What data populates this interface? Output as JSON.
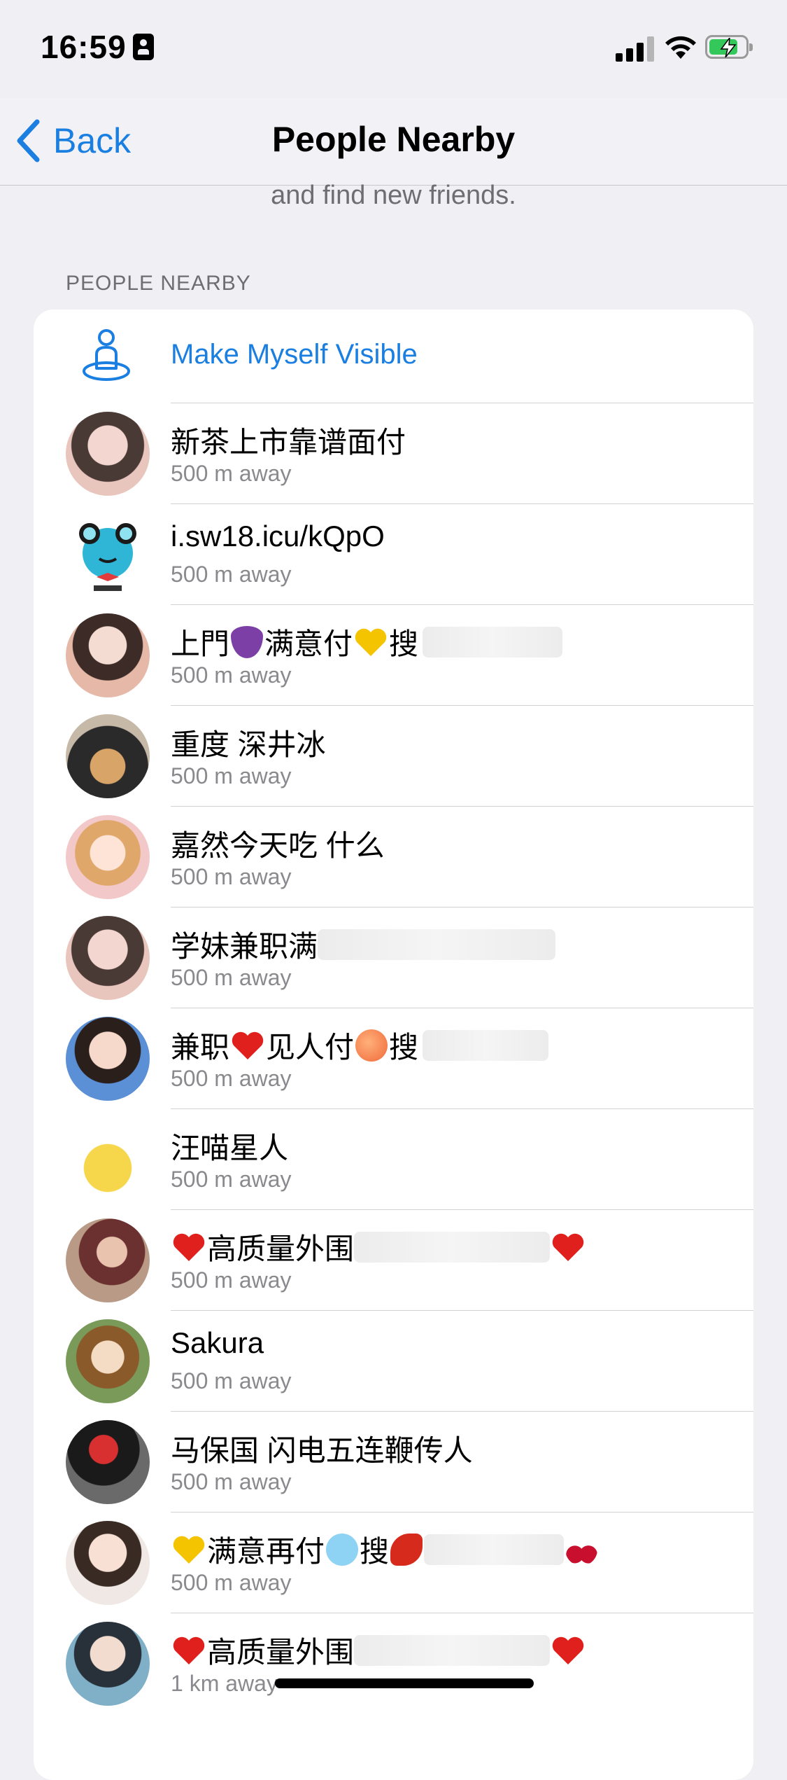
{
  "status": {
    "time": "16:59"
  },
  "nav": {
    "back_label": "Back",
    "title": "People Nearby"
  },
  "subtitle": "and find new friends.",
  "section_header": "PEOPLE NEARBY",
  "make_visible_label": "Make Myself Visible",
  "people": [
    {
      "name": "新茶上市靠谱面付",
      "distance": "500 m away"
    },
    {
      "name": "i.sw18.icu/kQpO",
      "distance": "500 m away"
    },
    {
      "name_prefix": "上門",
      "name_mid": "满意付",
      "name_suffix": "搜",
      "distance": "500 m away"
    },
    {
      "name": "重度 深井冰",
      "distance": "500 m away"
    },
    {
      "name": "嘉然今天吃 什么",
      "distance": "500 m away"
    },
    {
      "name": "学妹兼职满",
      "distance": "500 m away"
    },
    {
      "name_prefix": "兼职",
      "name_mid": "见人付",
      "name_suffix": "搜",
      "distance": "500 m away"
    },
    {
      "name": "汪喵星人",
      "distance": "500 m away"
    },
    {
      "name": "高质量外围",
      "distance": "500 m away"
    },
    {
      "name": "Sakura",
      "distance": "500 m away"
    },
    {
      "name": "马保国 闪电五连鞭传人",
      "distance": "500 m away"
    },
    {
      "name_prefix": "满意再付",
      "name_suffix": "搜",
      "distance": "500 m away"
    },
    {
      "name": "高质量外围",
      "distance": "1 km away"
    }
  ],
  "colors": {
    "accent": "#1a7fe0",
    "background": "#efeff4",
    "secondary_text": "#8a8a8e"
  }
}
